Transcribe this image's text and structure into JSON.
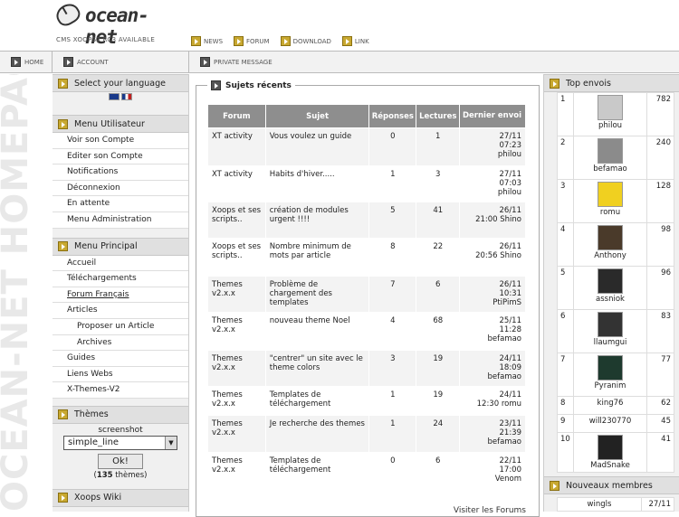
{
  "header": {
    "logo_text": "ocean-net",
    "tagline": "CMS XOOPS2 RC3 AVAILABLE",
    "links": [
      "NEWS",
      "FORUM",
      "DOWNLOAD",
      "LINK"
    ]
  },
  "nav": {
    "home": "HOME",
    "account": "ACCOUNT",
    "private_message": "PRIVATE MESSAGE"
  },
  "watermark": "OCEAN-NET HOMEPAGE",
  "left": {
    "language": {
      "title": "Select your language"
    },
    "user_menu": {
      "title": "Menu Utilisateur",
      "items": [
        "Voir son Compte",
        "Editer son Compte",
        "Notifications",
        "Déconnexion",
        "En attente",
        "Menu Administration"
      ]
    },
    "main_menu": {
      "title": "Menu Principal",
      "items": [
        "Accueil",
        "Téléchargements",
        "Forum Français",
        "Articles",
        "Proposer un Article",
        "Archives",
        "Guides",
        "Liens Webs",
        "X-Themes-V2"
      ]
    },
    "themes": {
      "title": "Thèmes",
      "screenshot_label": "screenshot",
      "selected": "simple_line",
      "ok_button": "Ok!",
      "count": "135",
      "count_suffix": " thèmes"
    },
    "wiki": {
      "title": "Xoops Wiki"
    }
  },
  "recent": {
    "title": "Sujets récents",
    "columns": [
      "Forum",
      "Sujet",
      "Réponses",
      "Lectures",
      "Dernier envoi"
    ],
    "rows": [
      {
        "forum": "XT activity",
        "subject": "Vous voulez un guide",
        "replies": "0",
        "reads": "1",
        "last": "27/11\n07:23\nphilou"
      },
      {
        "forum": "XT activity",
        "subject": "Habits d'hiver.....",
        "replies": "1",
        "reads": "3",
        "last": "27/11\n07:03\nphilou"
      },
      {
        "forum": "Xoops et ses scripts..",
        "subject": "création de modules urgent !!!!",
        "replies": "5",
        "reads": "41",
        "last": "26/11\n21:00 Shino"
      },
      {
        "forum": "Xoops et ses scripts..",
        "subject": "Nombre minimum de mots par article",
        "replies": "8",
        "reads": "22",
        "last": "26/11\n20:56 Shino"
      },
      {
        "forum": "Themes v2.x.x",
        "subject": "Problème de chargement des templates",
        "replies": "7",
        "reads": "6",
        "last": "26/11\n10:31\nPtiPimS"
      },
      {
        "forum": "Themes v2.x.x",
        "subject": "nouveau theme Noel",
        "replies": "4",
        "reads": "68",
        "last": "25/11\n11:28\nbefamao"
      },
      {
        "forum": "Themes v2.x.x",
        "subject": "\"centrer\" un site avec le theme colors",
        "replies": "3",
        "reads": "19",
        "last": "24/11\n18:09\nbefamao"
      },
      {
        "forum": "Themes v2.x.x",
        "subject": "Templates de téléchargement",
        "replies": "1",
        "reads": "19",
        "last": "24/11\n12:30 romu"
      },
      {
        "forum": "Themes v2.x.x",
        "subject": "Je recherche des themes",
        "replies": "1",
        "reads": "24",
        "last": "23/11\n21:39\nbefamao"
      },
      {
        "forum": "Themes v2.x.x",
        "subject": "Templates de téléchargement",
        "replies": "0",
        "reads": "6",
        "last": "22/11\n17:00\nVenom"
      }
    ],
    "visit_link": "Visiter les Forums"
  },
  "right": {
    "top_title": "Top envois",
    "top": [
      {
        "rank": "1",
        "name": "philou",
        "posts": "782",
        "avatar_color": "#c9c9c9"
      },
      {
        "rank": "2",
        "name": "befamao",
        "posts": "240",
        "avatar_color": "#8b8b8b"
      },
      {
        "rank": "3",
        "name": "romu",
        "posts": "128",
        "avatar_color": "#f0d020"
      },
      {
        "rank": "4",
        "name": "Anthony",
        "posts": "98",
        "avatar_color": "#4a3a2a"
      },
      {
        "rank": "5",
        "name": "assniok",
        "posts": "96",
        "avatar_color": "#2a2a2a"
      },
      {
        "rank": "6",
        "name": "llaumgui",
        "posts": "83",
        "avatar_color": "#333333"
      },
      {
        "rank": "7",
        "name": "Pyranim",
        "posts": "77",
        "avatar_color": "#1e3a2e"
      },
      {
        "rank": "8",
        "name": "king76",
        "posts": "62"
      },
      {
        "rank": "9",
        "name": "will230770",
        "posts": "45"
      },
      {
        "rank": "10",
        "name": "MadSnake",
        "posts": "41",
        "avatar_color": "#222222"
      }
    ],
    "new_members_title": "Nouveaux membres",
    "new_members": [
      {
        "name": "wingls",
        "date": "27/11"
      }
    ]
  }
}
